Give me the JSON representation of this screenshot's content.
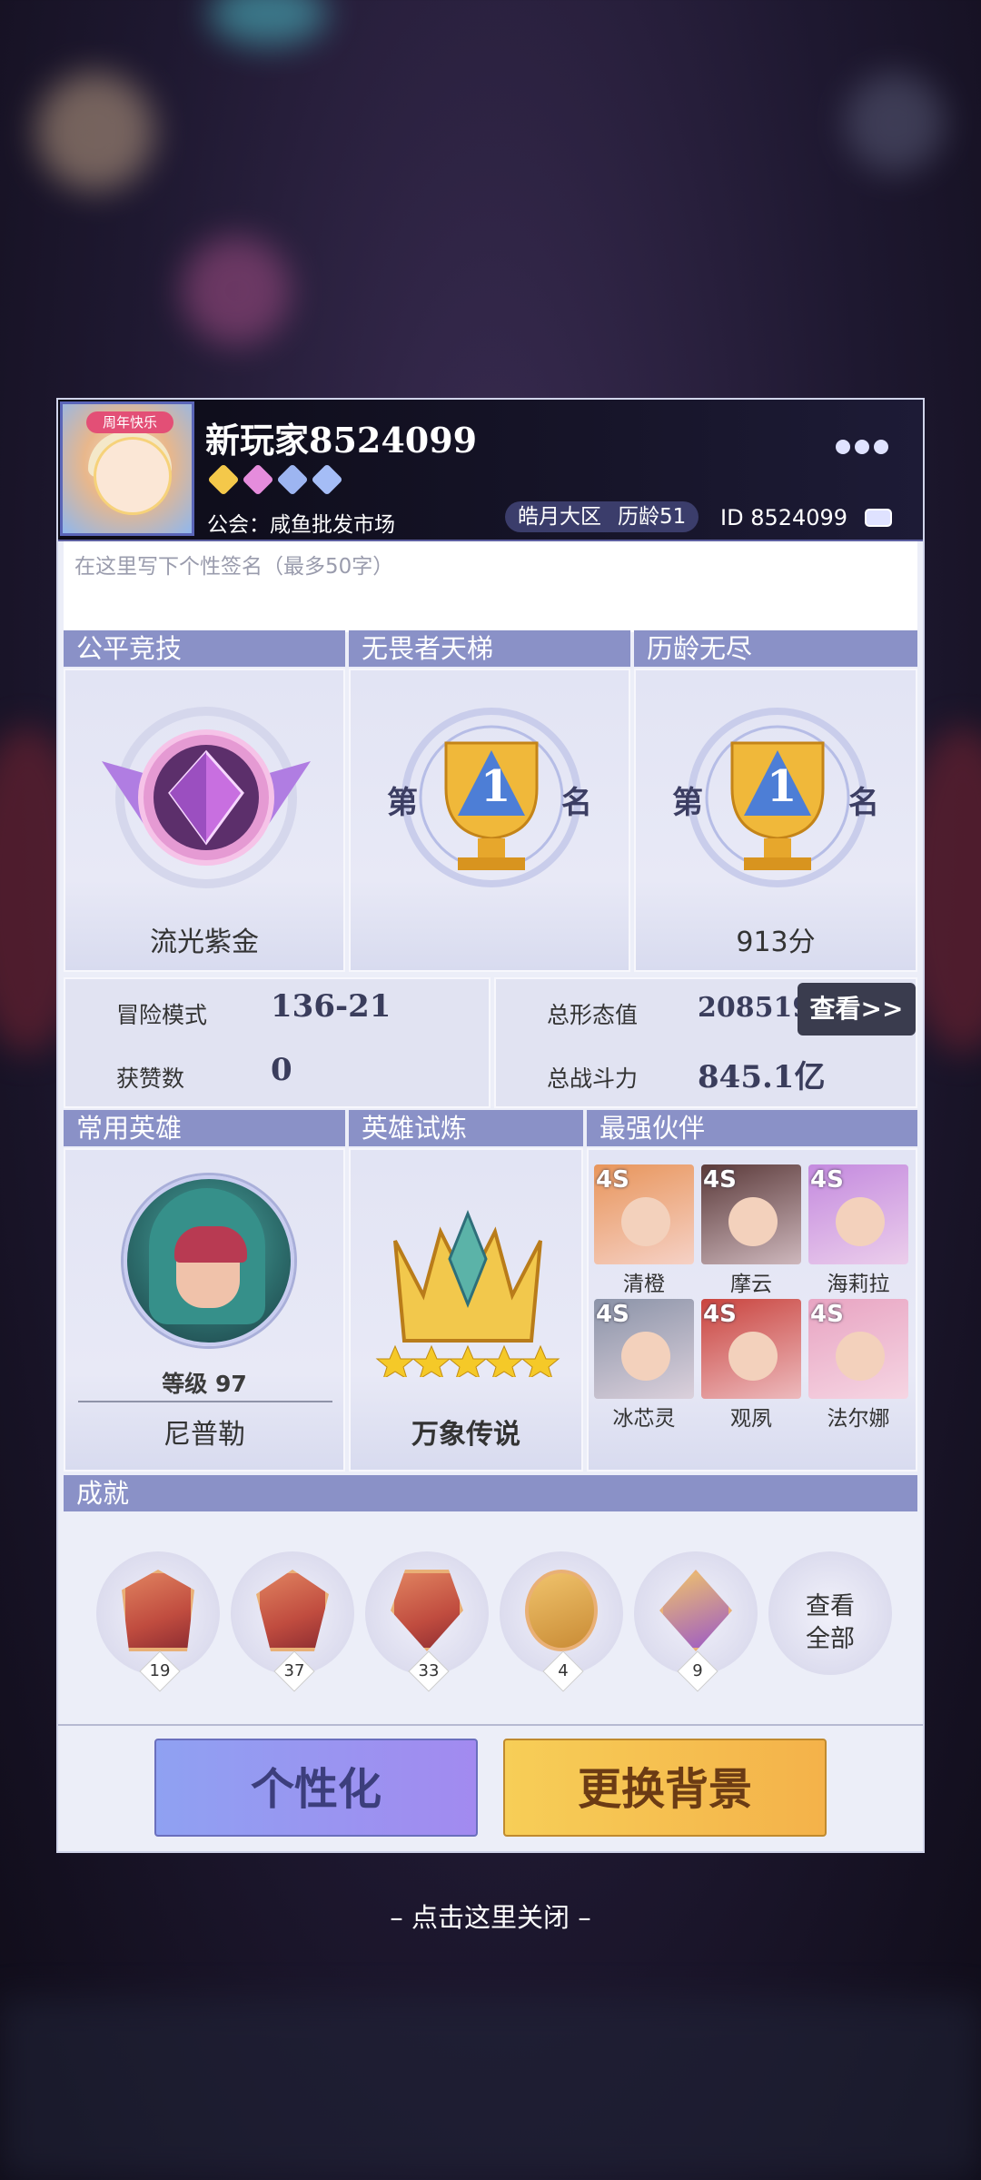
{
  "profile": {
    "avatar_badge": "周年快乐",
    "name": "新玩家8524099",
    "guild": "公会：咸鱼批发市场",
    "server": "皓月大区",
    "tenure": "历龄51",
    "id": "ID 8524099",
    "signature_placeholder": "在这里写下个性签名（最多50字）",
    "gem_colors": [
      "#f4c84a",
      "#e58cdc",
      "#9db5f1",
      "#a5bdf6"
    ]
  },
  "ranks": {
    "fair": {
      "title": "公平竞技",
      "label": "流光紫金"
    },
    "ladder": {
      "title": "无畏者天梯",
      "pre": "第",
      "num": "1",
      "post": "名"
    },
    "endless": {
      "title": "历龄无尽",
      "pre": "第",
      "num": "1",
      "post": "名",
      "label": "913分"
    }
  },
  "stats": {
    "adventure_label": "冒险模式",
    "adventure_value": "136-21",
    "likes_label": "获赞数",
    "likes_value": "0",
    "form_label": "总形态值",
    "form_value": "208519",
    "view_button": "查看>>",
    "power_label": "总战斗力",
    "power_value": "845.1亿"
  },
  "common_hero": {
    "title": "常用英雄",
    "level": "等级 97",
    "name": "尼普勒"
  },
  "hero_trial": {
    "title": "英雄试炼",
    "label": "万象传说"
  },
  "partners": {
    "title": "最强伙伴",
    "items": [
      {
        "tag": "4S",
        "name": "清橙",
        "color": "#e8955b"
      },
      {
        "tag": "4S",
        "name": "摩云",
        "color": "#5b3a3a"
      },
      {
        "tag": "4S",
        "name": "海莉拉",
        "color": "#c48adf"
      },
      {
        "tag": "4S",
        "name": "冰芯灵",
        "color": "#8b93a8"
      },
      {
        "tag": "4S",
        "name": "观夙",
        "color": "#c9443e"
      },
      {
        "tag": "4S",
        "name": "法尔娜",
        "color": "#e8a4c2"
      }
    ]
  },
  "achievements": {
    "title": "成就",
    "counts": [
      "19",
      "37",
      "33",
      "4",
      "9"
    ],
    "view_all_1": "查看",
    "view_all_2": "全部"
  },
  "buttons": {
    "personalize": "个性化",
    "change_bg": "更换背景"
  },
  "close_hint": "– 点击这里关闭 –"
}
